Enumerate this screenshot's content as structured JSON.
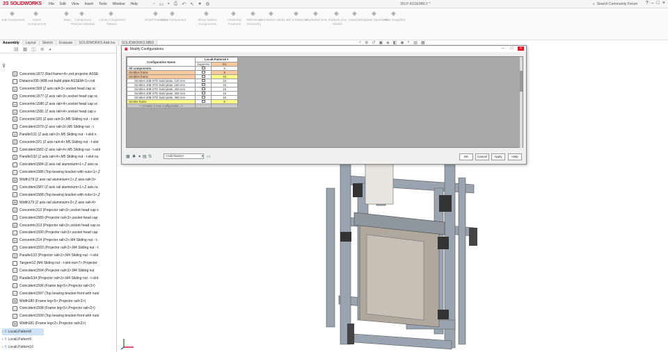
{
  "app": {
    "brand": "SOLIDWORKS",
    "doc_title": "3DLP ASSEMBLY *",
    "search_placeholder": "Search Community Forum",
    "menus": [
      "File",
      "Edit",
      "View",
      "Insert",
      "Tools",
      "Window",
      "Help"
    ],
    "window_controls": [
      "?",
      "–",
      "□",
      "×"
    ]
  },
  "ribbon": {
    "items": [
      "Edit Component",
      "Insert Components",
      "Mate",
      "Component Preview Window",
      "Linear Component Pattern",
      "Smart Fasteners",
      "Move Component",
      "Show Hidden Components",
      "Assembly Features",
      "Reference Geometry",
      "New Motion Study",
      "Bill of Materials",
      "Exploded View",
      "Explode Line Sketch",
      "Instant3D",
      "Update Speedpak",
      "Take Snapshot"
    ]
  },
  "tabs": [
    "Assembly",
    "Layout",
    "Sketch",
    "Evaluate",
    "SOLIDWORKS Add-Ins",
    "SOLIDWORKS MBD"
  ],
  "feature_tree": {
    "mates": [
      {
        "icon": "concentric",
        "text": "Concentric1572 (Rail frame<4>,rod projector ASSE"
      },
      {
        "icon": "distance",
        "text": "Distance295 (40B rod build plate ASSEM<1>,rod"
      },
      {
        "icon": "concentric",
        "text": "Concentric309 (Z axis rail<3>,socket head cap sc"
      },
      {
        "icon": "concentric",
        "text": "Concentric1577 (Z axis rail<3>,socket head cap sc"
      },
      {
        "icon": "concentric",
        "text": "Concentric1580 (Z axis rail<4>,socket head cap sc"
      },
      {
        "icon": "concentric",
        "text": "Concentric1581 (Z axis rail<4>,socket head cap s"
      },
      {
        "icon": "concentric",
        "text": "Concentric320 (Z axis rail<3>,M5 Sliding nut - t-slot"
      },
      {
        "icon": "coincident",
        "text": "Coincident1579 (Z axis rail<3>,M5 Sliding nut - t"
      },
      {
        "icon": "parallel",
        "text": "Parallel131 (Z axis rail<3>,M5 Sliding nut - t-slot n"
      },
      {
        "icon": "concentric",
        "text": "Concentric321 (Z axis rail<4>,M5 Sliding nut - t-slot"
      },
      {
        "icon": "coincident",
        "text": "Coincident1582 (Z axis rail<4>,M5 Sliding nut - t-slot"
      },
      {
        "icon": "parallel",
        "text": "Parallel132 (Z axis rail<4>,M5 Sliding nut - t-slot nu"
      },
      {
        "icon": "coincident",
        "text": "Coincident1584 (Z axis rail aluminium<1>,Z axis ra"
      },
      {
        "icon": "coincident",
        "text": "Coincident1586 (Top bearing bracket with nuts<1>,Z"
      },
      {
        "icon": "width",
        "text": "Width178 (Z axis rail aluminium<1>,Z axis rail<3>"
      },
      {
        "icon": "coincident",
        "text": "Coincident1587 (Z axis rail aluminium<1>,Z axis ra"
      },
      {
        "icon": "coincident",
        "text": "Coincident1588 (Top bearing bracket with nuts<1>,Z"
      },
      {
        "icon": "width",
        "text": "Width179 (Z axis rail aluminium<3>,Z axis rail<4>"
      },
      {
        "icon": "concentric",
        "text": "Concentric312 (Projector rail<3>,socket head cap s"
      },
      {
        "icon": "coincident",
        "text": "Coincident1589 (Projector rail<3>,socket head cap"
      },
      {
        "icon": "concentric",
        "text": "Concentric313 (Projector rail<3>,socket head cap sc"
      },
      {
        "icon": "coincident",
        "text": "Coincident1590 (Projector rail<3>,socket head cap"
      },
      {
        "icon": "concentric",
        "text": "Concentric314 (Projector rail<2>,M4 Sliding nut - t-"
      },
      {
        "icon": "coincident",
        "text": "Coincident1593 (Projector rail<2>,M4 Sliding nut - t"
      },
      {
        "icon": "parallel",
        "text": "Parallel133 (Projector rail<2>,M4 Sliding nut - t-slot"
      },
      {
        "icon": "tangent",
        "text": "Tangent12 (M4 Sliding nut - t-slot nut<7>,Projector"
      },
      {
        "icon": "coincident",
        "text": "Coincident1594 (Projector rail<3>,M4 Sliding nut"
      },
      {
        "icon": "parallel",
        "text": "Parallel134 (Projector rail<3>,M4 Sliding nut - t-slot"
      },
      {
        "icon": "coincident",
        "text": "Coincident1596 (Frame leg<5>,Projector rail<3>)"
      },
      {
        "icon": "coincident",
        "text": "Coincident1597 (Top bearing bracket front with nuts"
      },
      {
        "icon": "width",
        "text": "Width180 (Frame leg<5>,Projector rail<3>)"
      },
      {
        "icon": "coincident",
        "text": "Coincident1598 (Frame leg<5>,Projector rail<2>)"
      },
      {
        "icon": "coincident",
        "text": "Coincident1599 (Top bearing bracket front with nuts"
      },
      {
        "icon": "width",
        "text": "Width181 (Frame leg<2>,Projector rail<2>)"
      }
    ],
    "patterns": [
      "LocalLPattern8",
      "LocalLPattern9",
      "LocalLPattern10"
    ]
  },
  "dialog": {
    "title": "Modify Configurations",
    "header": {
      "config_name": "Configuration Name",
      "group": "LocalLPattern8",
      "suppress": "Suppress",
      "col": "D1"
    },
    "rows": [
      {
        "name": "All components",
        "val": "5",
        "style": "white",
        "bold": true
      },
      {
        "name": "Gimbles frame",
        "val": "5",
        "style": "orange"
      },
      {
        "name": "Gimbles frame",
        "val": "15",
        "style": "orange",
        "valstyle": "yellow"
      },
      {
        "name": "Gimbles 40B STD build plate, 120 mm",
        "val": "15",
        "style": "white"
      },
      {
        "name": "Gimbles 40B STD build plate, 180 mm",
        "val": "15",
        "style": "white"
      },
      {
        "name": "Gimbles 40B STD build plate, 250 mm",
        "val": "15",
        "style": "white"
      },
      {
        "name": "Gimbles 40B STD build plate, 300 mm",
        "val": "15",
        "style": "white"
      },
      {
        "name": "Gimbles 40B STD build plate, 360 mm",
        "val": "15",
        "style": "white"
      },
      {
        "name": "Gimble frame",
        "val": "5",
        "style": "yellow"
      },
      {
        "name": "< Creates a new configuration. >",
        "val": "",
        "style": "gray"
      }
    ],
    "view_select": "<Add Name>",
    "buttons": {
      "ok": "OK",
      "cancel": "Cancel",
      "apply": "Apply",
      "help": "Help"
    }
  }
}
